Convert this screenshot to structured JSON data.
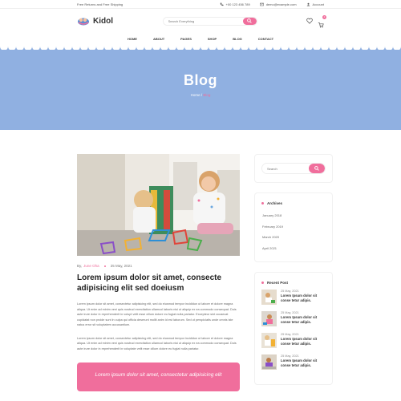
{
  "topbar": {
    "promo": "Free Returns and Free Shipping",
    "phone": "+00 123 456 789",
    "email": "demo@example.com",
    "account": "Account"
  },
  "header": {
    "brand": "Kidol",
    "search_placeholder": "Search Everything",
    "cart_count": "2"
  },
  "nav": [
    "HOME",
    "ABOUT",
    "PAGES",
    "SHOP",
    "BLOG",
    "CONTACT"
  ],
  "banner": {
    "title": "Blog",
    "crumb_home": "Home",
    "crumb_sep": " / ",
    "crumb_current": "Blog"
  },
  "post": {
    "author_prefix": "By,",
    "author": "June Oha",
    "date": "25 May, 2021",
    "title": "Lorem ipsum dolor sit amet, consecte adipisicing elit sed doeiusm",
    "para1": "Lorem ipsum dolor sit amet, consectetur adipisicing elit, sed do eiusmod tempor incididun ut labore et dolore magna aliqua. Ut enim ad minim veni quis nostrud exercitation ullamcol laboris nisi ut aliquip ex ea commodo consequat. Duis aute irure dolor in reprehenderit in volupt velit esse cillum dolore eu fugiat nulla pariatur. Excepteur sint occaecat cupidatat non proide sunt in culpa qui officia deserunt mollit anim id est laborum. Sed ut perspiciatis unde omnis iste natus error sit voluptatem accusantium.",
    "para2": "Lorem ipsum dolor sit amet, consectetur adipisicing elit, sed do eiusmod tempor incididun ut labore et dolore magna aliqua. Ut enim ad minim veni quis nostrud exercitation ullamcol laboris nisi ut aliquip ex ea commodo consequat. Duis aute irure dolor in reprehenderit in voluptate velit esse cillum dolore eu fugiat nulla pariatur.",
    "quote": "Lorem ipsum dolor sit amet, consectetur adipisicing elit"
  },
  "sidebar": {
    "search_placeholder": "Search",
    "archives_title": "Archives",
    "archives": [
      "January 2018",
      "February 2019",
      "March 2020",
      "April 2021"
    ],
    "recent_title": "Recent Post",
    "recent": [
      {
        "date": "25 May, 2021",
        "title": "Lorem Ipsum dolor sit conse tetur adipis."
      },
      {
        "date": "25 May, 2021",
        "title": "Lorem Ipsum dolor sit conse tetur adipis."
      },
      {
        "date": "25 May, 2021",
        "title": "Lorem Ipsum dolor sit conse tetur adipis."
      },
      {
        "date": "25 May, 2021",
        "title": "Lorem Ipsum dolor sit conse tetur adipis."
      }
    ]
  },
  "colors": {
    "accent": "#f06e9c",
    "banner": "#90b0e1"
  }
}
